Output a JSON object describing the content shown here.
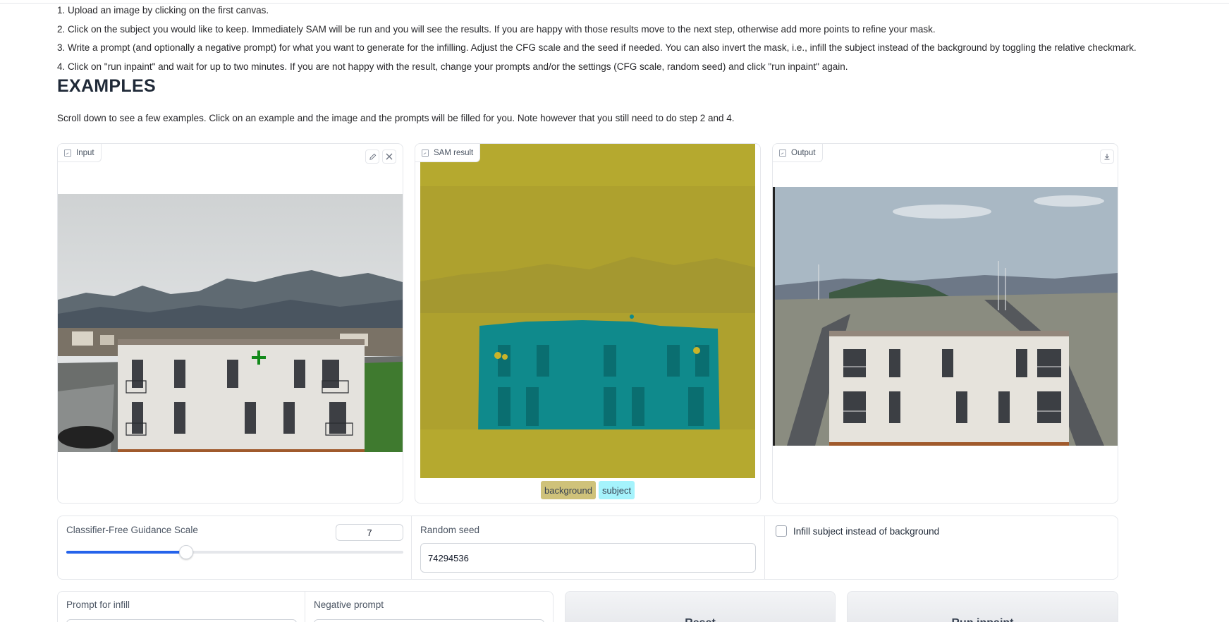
{
  "instructions": [
    "1. Upload an image by clicking on the first canvas.",
    "2. Click on the subject you would like to keep. Immediately SAM will be run and you will see the results. If you are happy with those results move to the next step, otherwise add more points to refine your mask.",
    "3. Write a prompt (and optionally a negative prompt) for what you want to generate for the infilling. Adjust the CFG scale and the seed if needed. You can also invert the mask, i.e., infill the subject instead of the background by toggling the relative checkmark.",
    "4. Click on \"run inpaint\" and wait for up to two minutes. If you are not happy with the result, change your prompts and/or the settings (CFG scale, random seed) and click \"run inpaint\" again."
  ],
  "examples": {
    "heading": "EXAMPLES",
    "note": "Scroll down to see a few examples. Click on an example and the image and the prompts will be filled for you. Note however that you still need to do step 2 and 4."
  },
  "panels": {
    "input_label": "Input",
    "sam_label": "SAM result",
    "output_label": "Output",
    "edit_icon": "pencil-icon",
    "clear_icon": "close-icon",
    "download_icon": "download-icon"
  },
  "legend": [
    {
      "label": "background",
      "color": "#cfc27a"
    },
    {
      "label": "subject",
      "color": "#a5f3fc"
    }
  ],
  "settings": {
    "cfg_label": "Classifier-Free Guidance Scale",
    "cfg_value": "7",
    "cfg_fraction": 0.355,
    "seed_label": "Random seed",
    "seed_value": "74294536",
    "invert_label": "Infill subject instead of background",
    "invert_checked": false
  },
  "prompts": {
    "prompt_label": "Prompt for infill",
    "negative_label": "Negative prompt"
  },
  "buttons": {
    "reset_label": "Reset",
    "run_label": "Run inpaint"
  },
  "colors": {
    "accent": "#2563eb",
    "sam_background": "#b5a92f",
    "sam_subject": "#0f8a8c"
  }
}
